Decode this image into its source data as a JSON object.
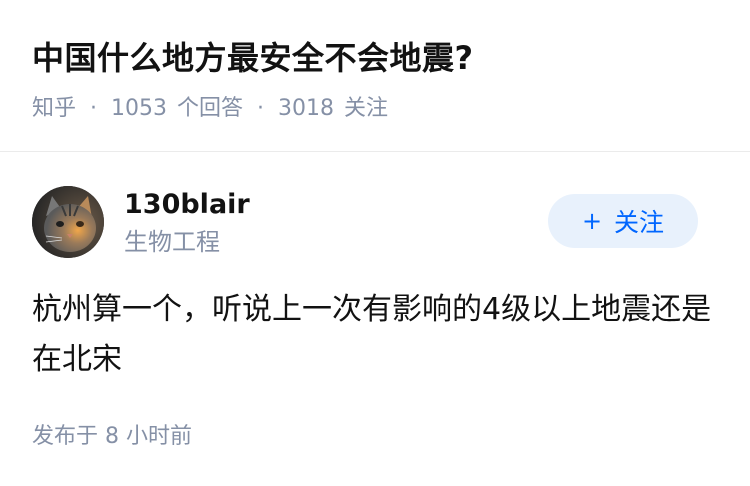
{
  "question": {
    "title": "中国什么地方最安全不会地震?",
    "source": "知乎",
    "separator": "·",
    "answer_count": "1053",
    "answer_label": "个回答",
    "follow_count": "3018",
    "follow_label": "关注"
  },
  "answer": {
    "author": {
      "name": "130blair",
      "bio": "生物工程",
      "avatar": "cat-avatar-icon"
    },
    "follow_button": {
      "plus": "+",
      "label": "关注"
    },
    "content": "杭州算一个，听说上一次有影响的4级以上地震还是在北宋",
    "time": "发布于  8 小时前"
  },
  "colors": {
    "text_primary": "#121212",
    "text_secondary": "#8590a6",
    "accent": "#0066ff",
    "button_bg": "#e8f1fc",
    "divider": "#ebebeb"
  }
}
